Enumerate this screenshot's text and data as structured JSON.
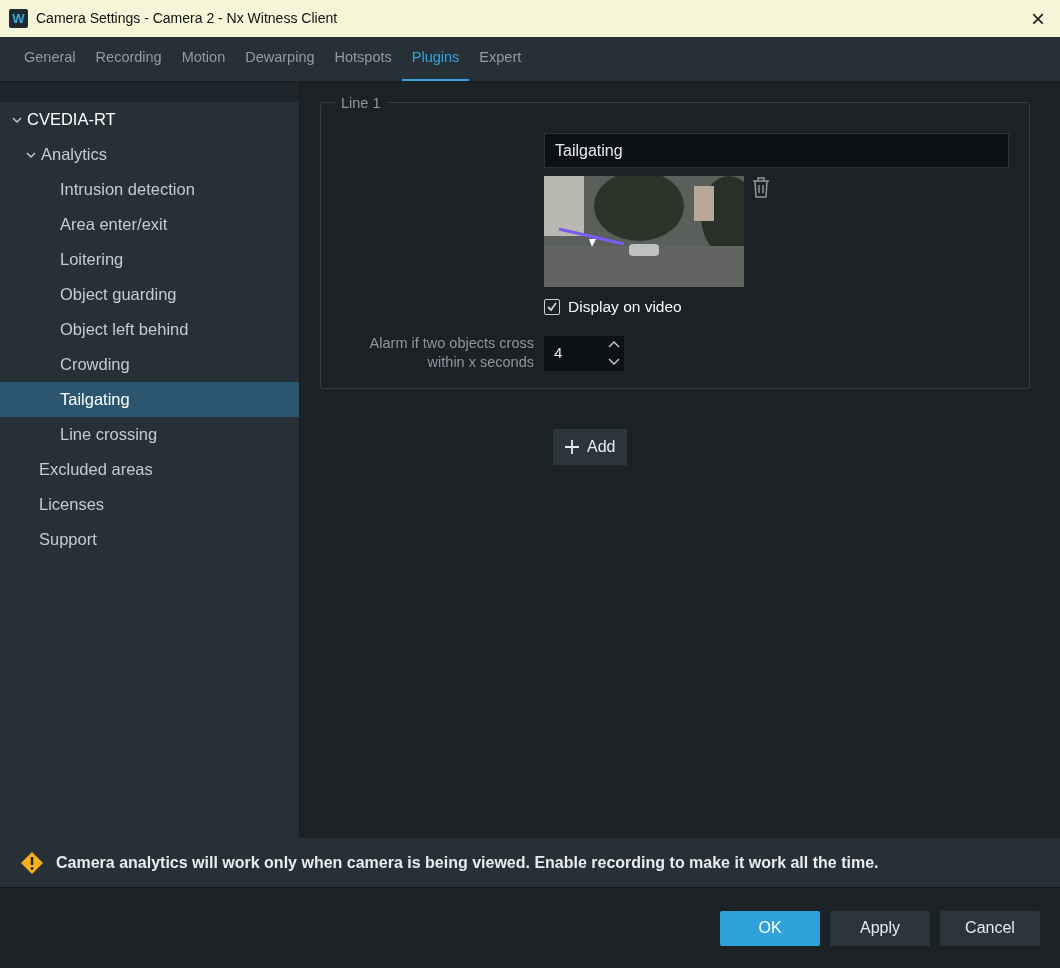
{
  "window": {
    "title": "Camera Settings - Camera 2 - Nx Witness Client",
    "logo": "W",
    "close": "×"
  },
  "tabs": [
    {
      "label": "General",
      "selected": false
    },
    {
      "label": "Recording",
      "selected": false
    },
    {
      "label": "Motion",
      "selected": false
    },
    {
      "label": "Dewarping",
      "selected": false
    },
    {
      "label": "Hotspots",
      "selected": false
    },
    {
      "label": "Plugins",
      "selected": true
    },
    {
      "label": "Expert",
      "selected": false
    }
  ],
  "sidebar": {
    "items": [
      {
        "label": "CVEDIA-RT",
        "expanded": true,
        "selected": false,
        "children": [
          {
            "label": "Analytics",
            "expanded": true,
            "selected": false,
            "children": [
              {
                "label": "Intrusion detection",
                "selected": false
              },
              {
                "label": "Area enter/exit",
                "selected": false
              },
              {
                "label": "Loitering",
                "selected": false
              },
              {
                "label": "Object guarding",
                "selected": false
              },
              {
                "label": "Object left behind",
                "selected": false
              },
              {
                "label": "Crowding",
                "selected": false
              },
              {
                "label": "Tailgating",
                "selected": true
              },
              {
                "label": "Line crossing",
                "selected": false
              }
            ]
          },
          {
            "label": "Excluded areas",
            "selected": false
          },
          {
            "label": "Licenses",
            "selected": false
          },
          {
            "label": "Support",
            "selected": false
          }
        ]
      }
    ]
  },
  "group": {
    "title": "Line 1",
    "name_value": "Tailgating",
    "display_on_video": {
      "label": "Display on video",
      "checked": true
    },
    "alarm": {
      "label": "Alarm if two objects cross within x seconds",
      "value": "4"
    }
  },
  "add_button": "Add",
  "warning": "Camera analytics will work only when camera is being viewed. Enable recording to make it work all the time.",
  "buttons": [
    {
      "label": "OK",
      "kind": "primary"
    },
    {
      "label": "Apply",
      "kind": "secondary"
    },
    {
      "label": "Cancel",
      "kind": "secondary"
    }
  ]
}
